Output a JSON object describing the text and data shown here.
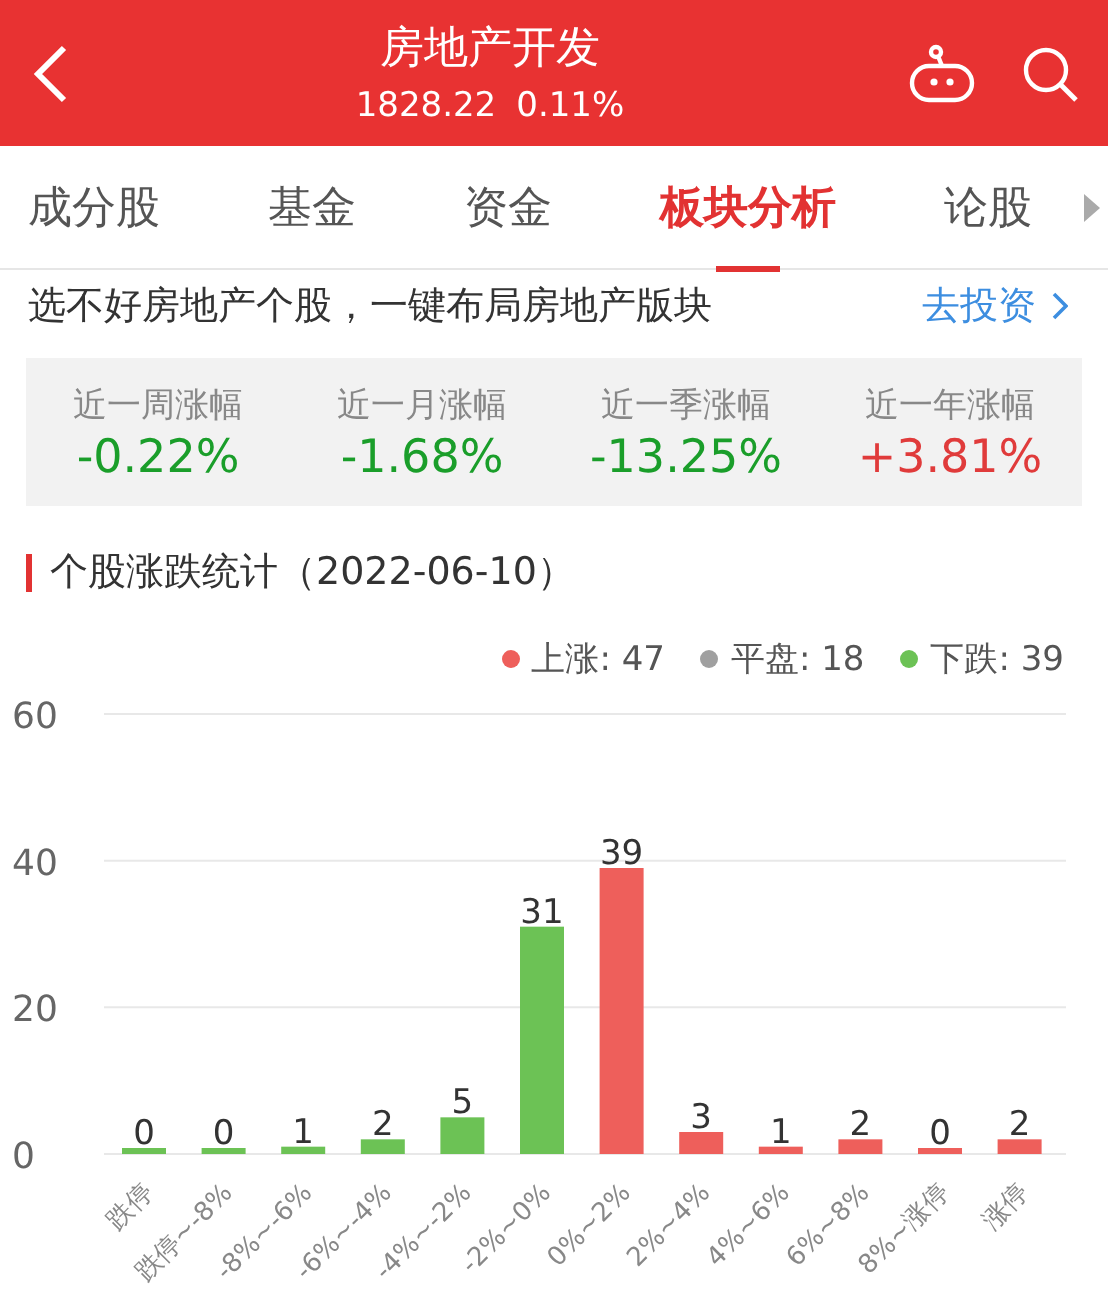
{
  "header": {
    "title": "房地产开发",
    "price": "1828.22",
    "change": "0.11%"
  },
  "tabs": [
    {
      "label": "成分股",
      "selected": false
    },
    {
      "label": "基金",
      "selected": false
    },
    {
      "label": "资金",
      "selected": false
    },
    {
      "label": "板块分析",
      "selected": true
    },
    {
      "label": "论股",
      "selected": false
    }
  ],
  "promo": {
    "text": "选不好房地产个股，一键布局房地产版块",
    "link": "去投资"
  },
  "stats": [
    {
      "label": "近一周涨幅",
      "value": "-0.22%",
      "kind": "down"
    },
    {
      "label": "近一月涨幅",
      "value": "-1.68%",
      "kind": "down"
    },
    {
      "label": "近一季涨幅",
      "value": "-13.25%",
      "kind": "down"
    },
    {
      "label": "近一年涨幅",
      "value": "+3.81%",
      "kind": "up"
    }
  ],
  "section_title": "个股涨跌统计（2022-06-10）",
  "legend": [
    {
      "label": "上涨: 47",
      "color": "#ee5f5b"
    },
    {
      "label": "平盘: 18",
      "color": "#a0a0a0"
    },
    {
      "label": "下跌: 39",
      "color": "#6cc255"
    }
  ],
  "chart_data": {
    "type": "bar",
    "categories": [
      "跌停",
      "跌停~-8%",
      "-8%~-6%",
      "-6%~-4%",
      "-4%~-2%",
      "-2%~0%",
      "0%~2%",
      "2%~4%",
      "4%~6%",
      "6%~8%",
      "8%~涨停",
      "涨停"
    ],
    "series": [
      {
        "color": "#6cc255",
        "values": [
          0,
          0,
          1,
          2,
          5,
          31,
          null,
          null,
          null,
          null,
          null,
          null
        ]
      },
      {
        "color": "#ee5f5b",
        "values": [
          null,
          null,
          null,
          null,
          null,
          null,
          39,
          3,
          1,
          2,
          0,
          2
        ]
      }
    ],
    "ylim": [
      0,
      60
    ],
    "yticks": [
      0,
      20,
      40,
      60
    ],
    "data_labels": true
  }
}
